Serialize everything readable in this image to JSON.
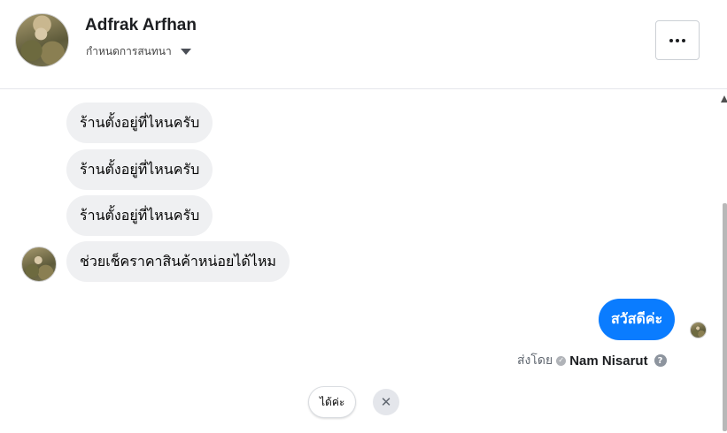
{
  "header": {
    "contact_name": "Adfrak Arfhan",
    "subtitle": "กำหนดการสนทนา",
    "more_label": "More options"
  },
  "messages": {
    "incoming": [
      "ร้านตั้งอยู่ที่ไหนครับ",
      "ร้านตั้งอยู่ที่ไหนครับ",
      "ร้านตั้งอยู่ที่ไหนครับ",
      "ช่วยเช็คราคาสินค้าหน่อยได้ไหม"
    ],
    "outgoing": [
      "สวัสดีค่ะ"
    ]
  },
  "sent_by": {
    "prefix": "ส่งโดย",
    "name": "Nam Nisarut"
  },
  "quick_reply": {
    "label": "ได้ค่ะ"
  },
  "colors": {
    "outgoing_bubble": "#0a7cff",
    "incoming_bubble": "#eff0f2"
  },
  "icons": [
    "caret-down-icon",
    "more-dots-icon",
    "check-circle-icon",
    "help-icon",
    "close-icon"
  ]
}
